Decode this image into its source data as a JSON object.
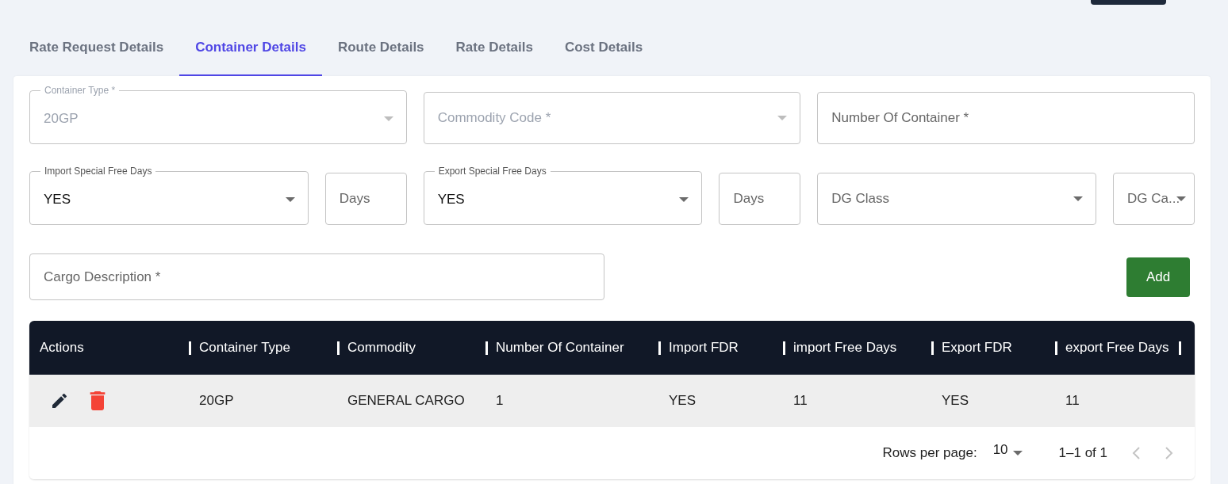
{
  "tabs": [
    {
      "label": "Rate Request Details",
      "selected": false
    },
    {
      "label": "Container Details",
      "selected": true
    },
    {
      "label": "Route Details",
      "selected": false
    },
    {
      "label": "Rate Details",
      "selected": false
    },
    {
      "label": "Cost Details",
      "selected": false
    }
  ],
  "form": {
    "lines": [
      {
        "fields": [
          {
            "kind": "select",
            "label": "Container Type *",
            "value": "20GP",
            "disabled": true
          },
          {
            "kind": "select",
            "placeholder": "Commodity Code *",
            "disabled": true
          },
          {
            "kind": "text",
            "placeholder": "Number Of Container *",
            "disabled": false
          }
        ]
      },
      {
        "fields": [
          {
            "kind": "select",
            "label": "Import Special Free Days",
            "value": "YES",
            "disabled": false
          },
          {
            "kind": "text",
            "placeholder": "Days",
            "disabled": false
          },
          {
            "kind": "select",
            "label": "Export Special Free Days",
            "value": "YES",
            "disabled": false
          },
          {
            "kind": "text",
            "placeholder": "Days",
            "disabled": false
          },
          {
            "kind": "select",
            "placeholder": "DG Class",
            "disabled": false
          },
          {
            "kind": "select",
            "placeholder": "DG Ca...",
            "disabled": false
          }
        ]
      },
      {
        "fields": [
          {
            "kind": "text",
            "placeholder": "Cargo Description *",
            "disabled": false
          }
        ]
      }
    ],
    "add_button": "Add"
  },
  "table": {
    "columns": [
      "Actions",
      "Container Type",
      "Commodity",
      "Number Of Container",
      "Import FDR",
      "import Free Days",
      "Export FDR",
      "export Free Days"
    ],
    "rows": [
      [
        "",
        "20GP",
        "GENERAL CARGO",
        "1",
        "YES",
        "11",
        "YES",
        "11"
      ]
    ]
  },
  "pager": {
    "rows_per_page_label": "Rows per page:",
    "rows_per_page": "10",
    "range": "1–1 of 1",
    "prev_disabled": true,
    "next_disabled": true
  }
}
